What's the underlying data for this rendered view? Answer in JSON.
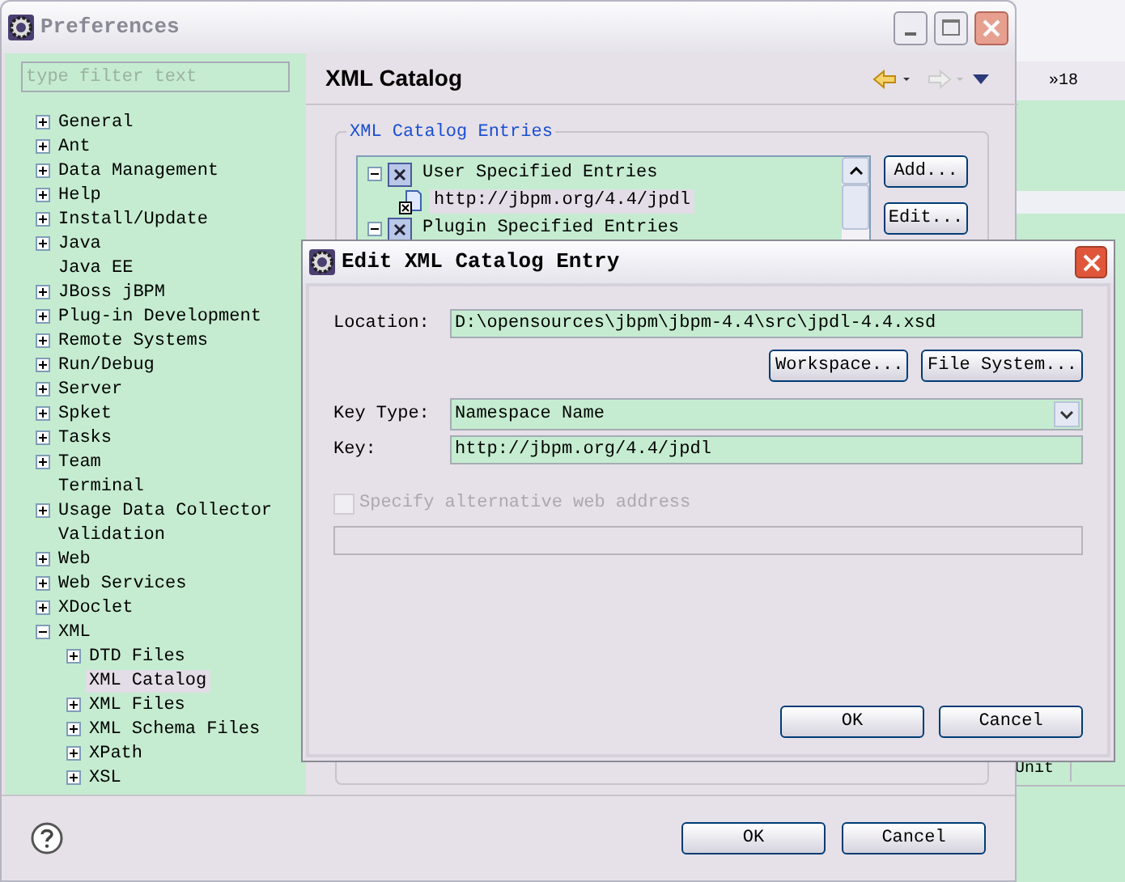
{
  "background_app": {
    "tab_label": "»18",
    "column_header": "Unit"
  },
  "preferences": {
    "title": "Preferences",
    "filter": {
      "placeholder": "type filter text"
    },
    "tree": [
      {
        "label": "General",
        "kind": "branch",
        "expanded": false,
        "selected": false
      },
      {
        "label": "Ant",
        "kind": "branch",
        "expanded": false,
        "selected": false
      },
      {
        "label": "Data Management",
        "kind": "branch",
        "expanded": false,
        "selected": false
      },
      {
        "label": "Help",
        "kind": "branch",
        "expanded": false,
        "selected": false
      },
      {
        "label": "Install/Update",
        "kind": "branch",
        "expanded": false,
        "selected": false
      },
      {
        "label": "Java",
        "kind": "branch",
        "expanded": false,
        "selected": false
      },
      {
        "label": "Java EE",
        "kind": "leaf",
        "selected": false
      },
      {
        "label": "JBoss jBPM",
        "kind": "branch",
        "expanded": false,
        "selected": false
      },
      {
        "label": "Plug-in Development",
        "kind": "branch",
        "expanded": false,
        "selected": false
      },
      {
        "label": "Remote Systems",
        "kind": "branch",
        "expanded": false,
        "selected": false
      },
      {
        "label": "Run/Debug",
        "kind": "branch",
        "expanded": false,
        "selected": false
      },
      {
        "label": "Server",
        "kind": "branch",
        "expanded": false,
        "selected": false
      },
      {
        "label": "Spket",
        "kind": "branch",
        "expanded": false,
        "selected": false
      },
      {
        "label": "Tasks",
        "kind": "branch",
        "expanded": false,
        "selected": false
      },
      {
        "label": "Team",
        "kind": "branch",
        "expanded": false,
        "selected": false
      },
      {
        "label": "Terminal",
        "kind": "leaf",
        "selected": false
      },
      {
        "label": "Usage Data Collector",
        "kind": "branch",
        "expanded": false,
        "selected": false
      },
      {
        "label": "Validation",
        "kind": "leaf",
        "selected": false
      },
      {
        "label": "Web",
        "kind": "branch",
        "expanded": false,
        "selected": false
      },
      {
        "label": "Web Services",
        "kind": "branch",
        "expanded": false,
        "selected": false
      },
      {
        "label": "XDoclet",
        "kind": "branch",
        "expanded": false,
        "selected": false
      },
      {
        "label": "XML",
        "kind": "branch",
        "expanded": true,
        "selected": false,
        "children": [
          {
            "label": "DTD Files",
            "kind": "branch",
            "expanded": false,
            "selected": false
          },
          {
            "label": "XML Catalog",
            "kind": "leaf",
            "selected": true
          },
          {
            "label": "XML Files",
            "kind": "branch",
            "expanded": false,
            "selected": false
          },
          {
            "label": "XML Schema Files",
            "kind": "branch",
            "expanded": false,
            "selected": false
          },
          {
            "label": "XPath",
            "kind": "branch",
            "expanded": false,
            "selected": false
          },
          {
            "label": "XSL",
            "kind": "branch",
            "expanded": false,
            "selected": false
          }
        ]
      }
    ],
    "page_title": "XML Catalog",
    "group": {
      "title": "XML Catalog Entries",
      "entries": [
        {
          "label": "User Specified Entries",
          "kind": "category",
          "expanded": true,
          "selected": false,
          "children": [
            {
              "label": "http://jbpm.org/4.4/jpdl",
              "kind": "entry",
              "selected": true
            }
          ]
        },
        {
          "label": "Plugin Specified Entries",
          "kind": "category",
          "expanded": true,
          "selected": false
        }
      ],
      "buttons": [
        "Add...",
        "Edit..."
      ]
    },
    "buttons": [
      "OK",
      "Cancel"
    ]
  },
  "dialog": {
    "title": "Edit XML Catalog Entry",
    "location": {
      "label": "Location:",
      "value": "D:\\opensources\\jbpm\\jbpm-4.4\\src\\jpdl-4.4.xsd"
    },
    "location_buttons": [
      "Workspace...",
      "File System..."
    ],
    "key_type": {
      "label": "Key Type:",
      "value": "Namespace Name"
    },
    "key": {
      "label": "Key:",
      "value": "http://jbpm.org/4.4/jpdl"
    },
    "alternative": {
      "label": "Specify alternative web address",
      "checked": false,
      "disabled": true
    },
    "buttons": [
      "OK",
      "Cancel"
    ]
  }
}
